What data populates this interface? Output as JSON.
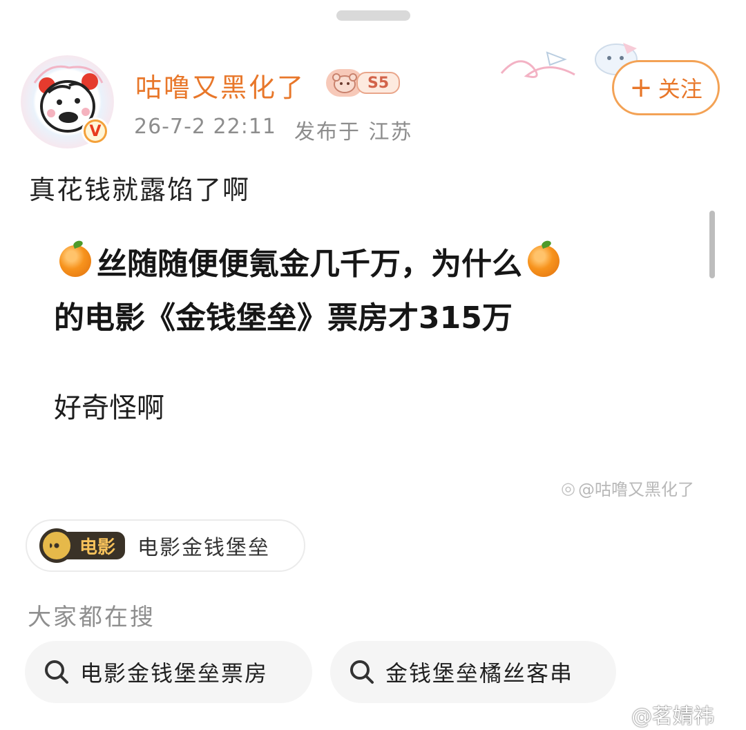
{
  "header": {
    "username": "咕噜又黑化了",
    "level_badge": "S5",
    "post_time": "26-7-2 22:11",
    "post_location": "发布于 江苏",
    "follow_label": "关注",
    "verified_mark": "V"
  },
  "post": {
    "text": "真花钱就露馅了啊",
    "embedded_image": {
      "line1": "丝随随便便氪金几千万，为什么",
      "line2": "的电影《金钱堡垒》票房才315万",
      "line3": "好奇怪啊",
      "watermark": "@咕噜又黑化了"
    }
  },
  "topic": {
    "tag": "电影",
    "label": "电影金钱堡垒"
  },
  "search": {
    "title": "大家都在搜",
    "items": [
      {
        "label": "电影金钱堡垒票房"
      },
      {
        "label": "金钱堡垒橘丝客串"
      }
    ]
  },
  "footer_watermark": "@茗婧祎",
  "colors": {
    "accent": "#e8772a",
    "follow_border": "#f3a255",
    "meta_gray": "#8d8d8d",
    "chip_bg": "#f5f5f5"
  },
  "icons": [
    "drag-handle",
    "verified-v-icon",
    "plus-icon",
    "orange-emoji-icon",
    "film-reel-icon",
    "search-icon",
    "weibo-logo-icon"
  ]
}
